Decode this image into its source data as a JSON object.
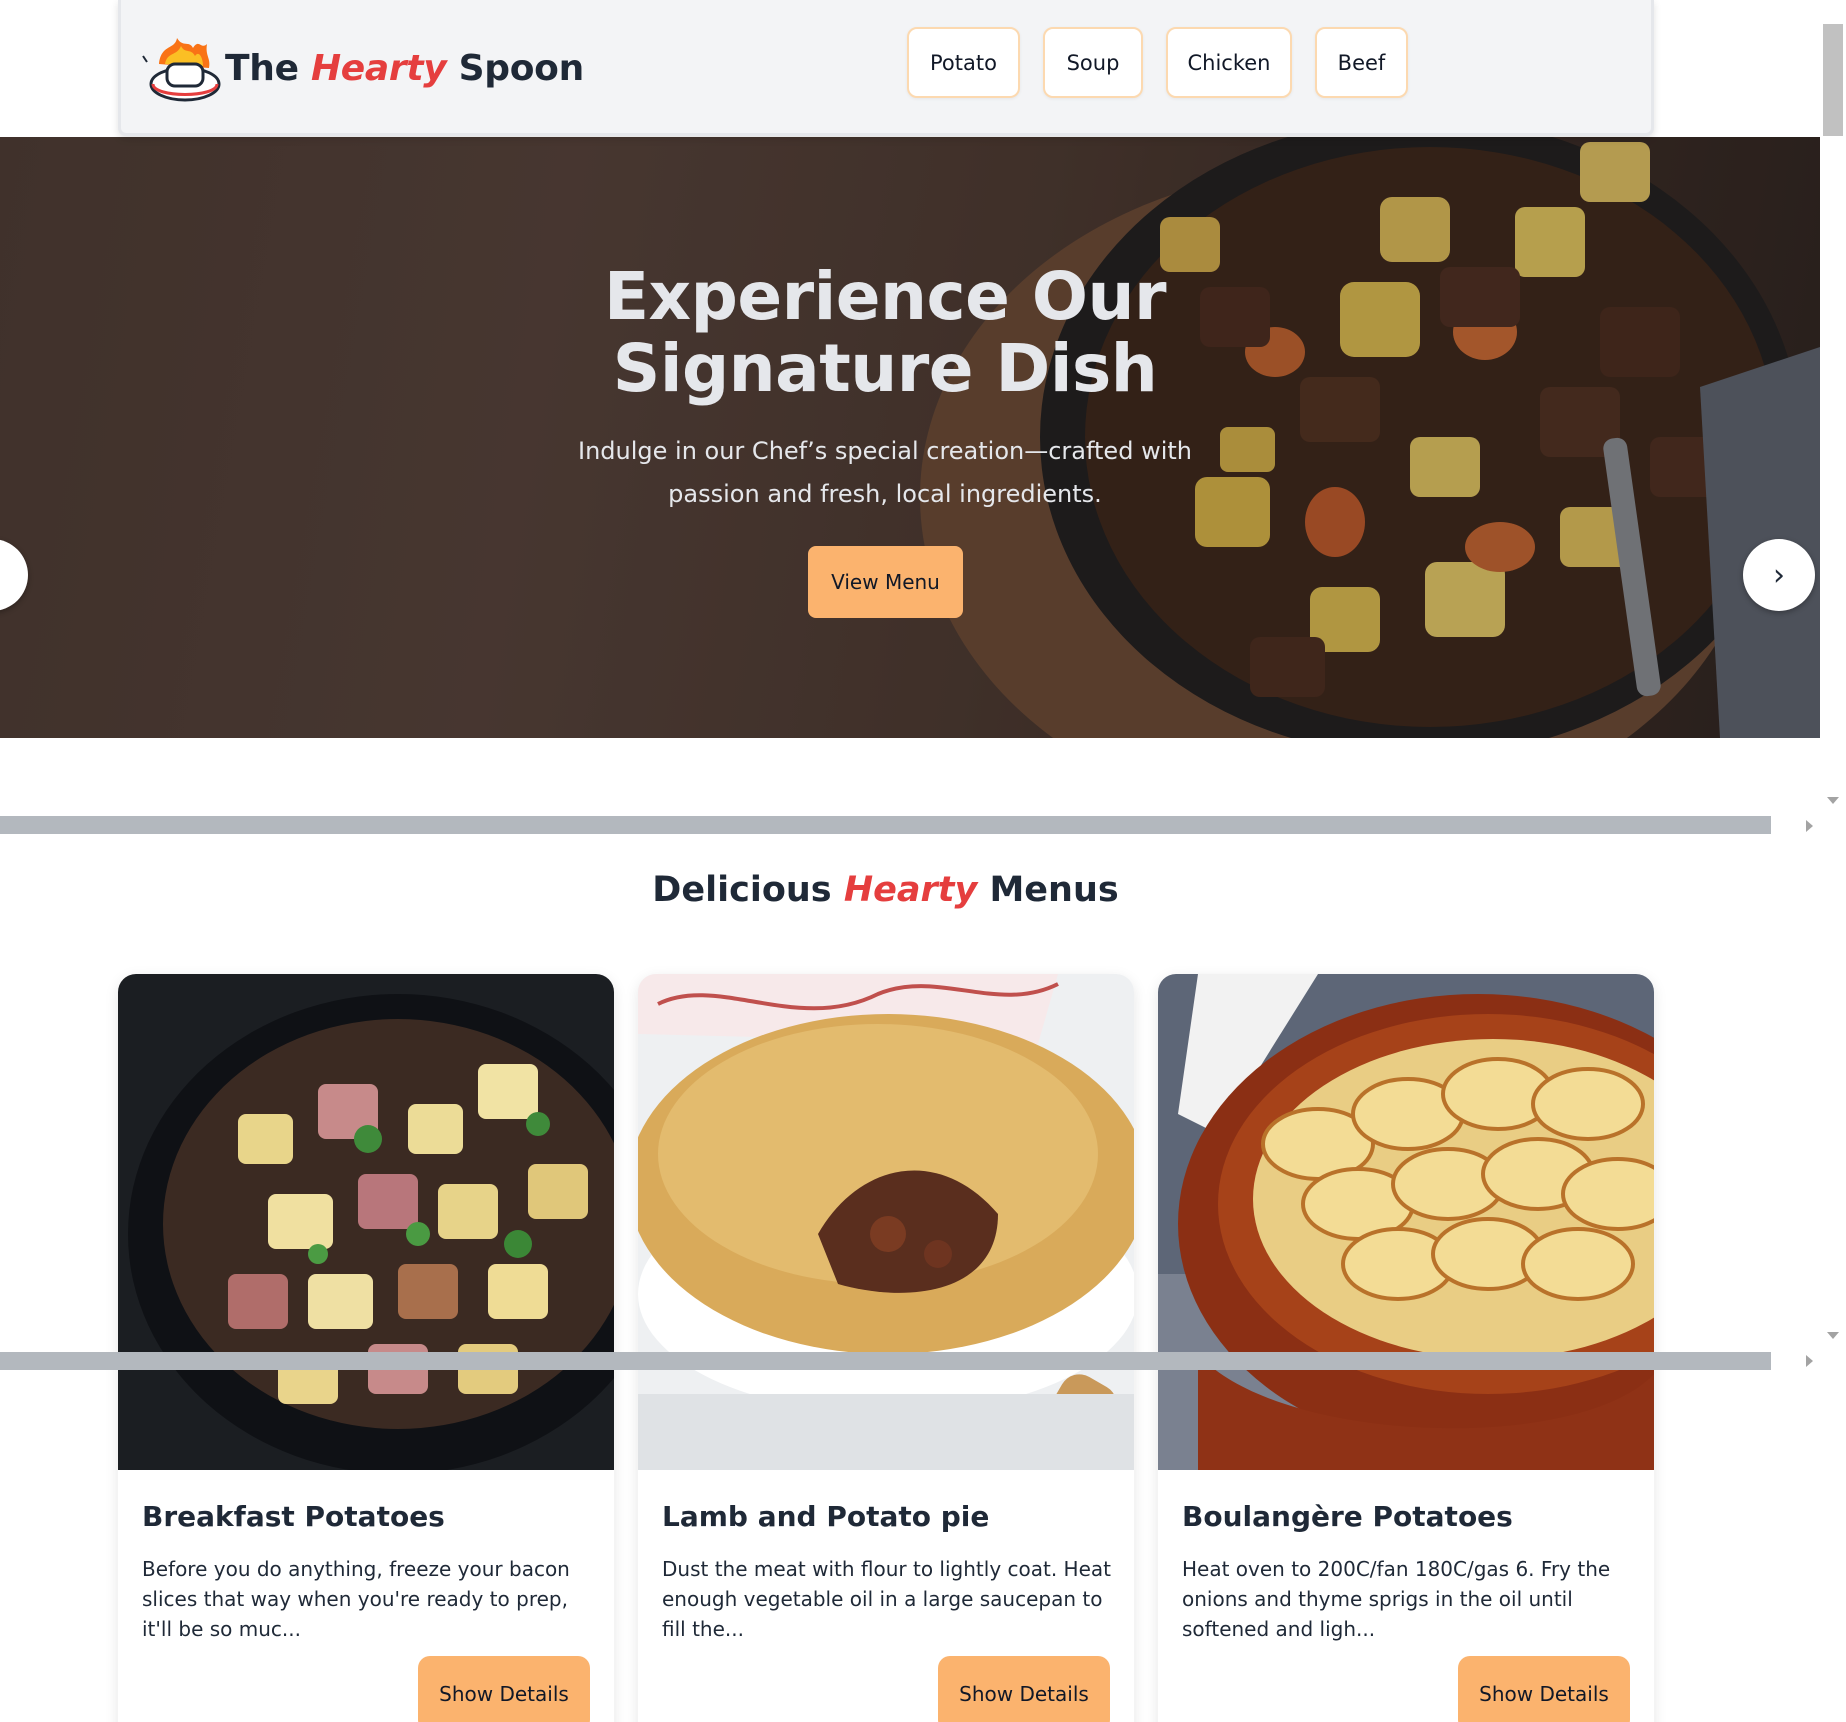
{
  "navbar": {
    "brand_prefix": "The",
    "brand_accent": "Hearty",
    "brand_suffix": "Spoon",
    "logo_icon": "chef-hat-icon",
    "items": [
      {
        "label": "Potato"
      },
      {
        "label": "Soup"
      },
      {
        "label": "Chicken"
      },
      {
        "label": "Beef"
      }
    ]
  },
  "hero": {
    "title": "Experience Our Signature Dish",
    "subtitle": "Indulge in our Chef’s special creation—crafted with passion and fresh, local ingredients.",
    "cta_label": "View Menu",
    "prev_icon": "chevron-left-icon",
    "next_label": "›",
    "next_icon": "chevron-right-icon"
  },
  "menus": {
    "title_prefix": "Delicious",
    "title_accent": "Hearty",
    "title_suffix": "Menus",
    "cards": [
      {
        "title": "Breakfast Potatoes",
        "description": "Before you do anything, freeze your bacon slices that way when you're ready to prep, it'll be so muc...",
        "button_label": "Show Details"
      },
      {
        "title": "Lamb and Potato pie",
        "description": "Dust the meat with flour to lightly coat. Heat enough vegetable oil in a large saucepan to fill the...",
        "button_label": "Show Details"
      },
      {
        "title": "Boulangère Potatoes",
        "description": "Heat oven to 200C/fan 180C/gas 6. Fry the onions and thyme sprigs in the oil until softened and ligh...",
        "button_label": "Show Details"
      }
    ]
  },
  "colors": {
    "accent": "#e53e3e",
    "button": "#fbb36e",
    "navbar_bg": "#f3f4f6",
    "text": "#1f2937"
  }
}
